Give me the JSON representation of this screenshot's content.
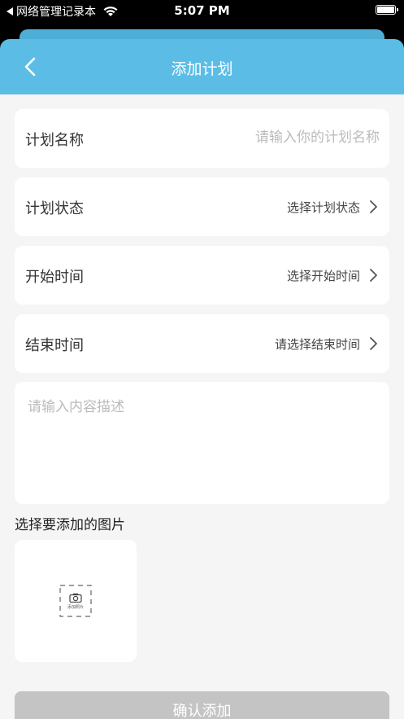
{
  "status_bar": {
    "carrier": "网络管理记录本",
    "time": "5:07 PM"
  },
  "header": {
    "title": "添加计划"
  },
  "form": {
    "plan_name": {
      "label": "计划名称",
      "placeholder": "请输入你的计划名称"
    },
    "plan_status": {
      "label": "计划状态",
      "value": "选择计划状态"
    },
    "start_time": {
      "label": "开始时间",
      "value": "选择开始时间"
    },
    "end_time": {
      "label": "结束时间",
      "value": "请选择结束时间"
    },
    "description": {
      "placeholder": "请输入内容描述"
    }
  },
  "photo": {
    "heading": "选择要添加的图片",
    "add_label": "添加照片"
  },
  "actions": {
    "confirm_label": "确认添加"
  },
  "colors": {
    "header_bg": "#5bbde6",
    "page_bg": "#f5f5f5",
    "button_disabled": "#c4c4c4"
  },
  "icons": {
    "back": "chevron-left-icon",
    "row_arrow": "chevron-right-icon",
    "add_photo": "camera-icon"
  }
}
